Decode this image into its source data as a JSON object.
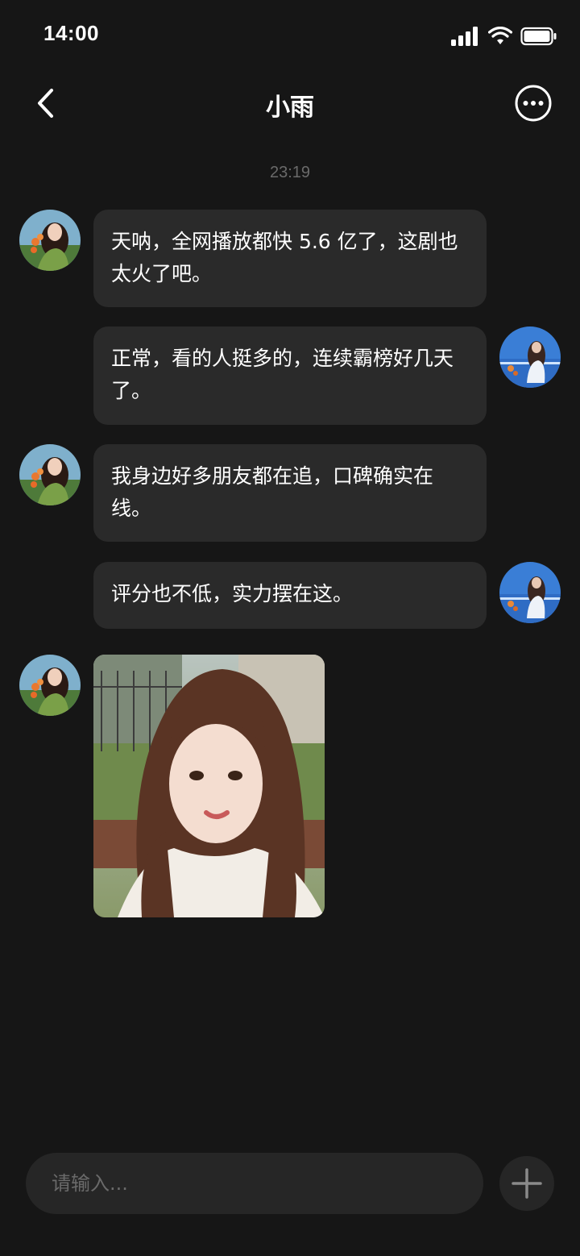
{
  "status_bar": {
    "time": "14:00"
  },
  "header": {
    "title": "小雨"
  },
  "conversation": {
    "timestamp": "23:19",
    "messages": [
      {
        "sender": "contact",
        "text": "天呐，全网播放都快 5.6 亿了，这剧也太火了吧。"
      },
      {
        "sender": "me",
        "text": "正常，看的人挺多的，连续霸榜好几天了。"
      },
      {
        "sender": "contact",
        "text": "我身边好多朋友都在追，口碑确实在线。"
      },
      {
        "sender": "me",
        "text": "评分也不低，实力摆在这。"
      },
      {
        "sender": "contact",
        "type": "image",
        "image": "portrait photo of a young woman with long brown hair"
      }
    ]
  },
  "composer": {
    "placeholder": "请输入..."
  },
  "icons": {
    "back": "chevron-left-icon",
    "more": "more-horizontal-circle-icon",
    "add": "plus-icon",
    "signal": "signal-icon",
    "wifi": "wifi-icon",
    "battery": "battery-icon"
  },
  "colors": {
    "background": "#161616",
    "bubble": "#2a2a2a",
    "input": "#262626",
    "muted": "#6a6a6a"
  }
}
